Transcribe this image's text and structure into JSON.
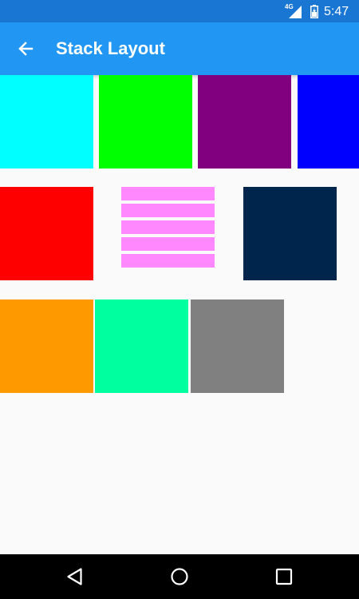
{
  "status_bar": {
    "network": "4G",
    "time": "5:47",
    "icons": [
      "signal-icon",
      "battery-icon"
    ]
  },
  "app_bar": {
    "title": "Stack Layout",
    "back_icon": "arrow-left-icon"
  },
  "colors": {
    "status_bar": "#1976d2",
    "app_bar": "#2196f3",
    "background": "#fafafa",
    "nav_bar": "#000000"
  },
  "stacks": [
    {
      "name": "row-1",
      "boxes": [
        {
          "color": "#00ffff"
        },
        {
          "color": "#00ff00"
        },
        {
          "color": "#800080"
        },
        {
          "color": "#0000ff"
        }
      ]
    },
    {
      "name": "row-2",
      "boxes": [
        {
          "color": "#ff0000"
        },
        {
          "color": "#ff88ff",
          "stripes": 5
        },
        {
          "color": "#00254d"
        }
      ]
    },
    {
      "name": "row-3",
      "boxes": [
        {
          "color": "#ff9900"
        },
        {
          "color": "#00ff9f"
        },
        {
          "color": "#808080"
        }
      ]
    }
  ],
  "nav_bar": {
    "icons": [
      "back-triangle-icon",
      "home-circle-icon",
      "recents-square-icon"
    ]
  }
}
